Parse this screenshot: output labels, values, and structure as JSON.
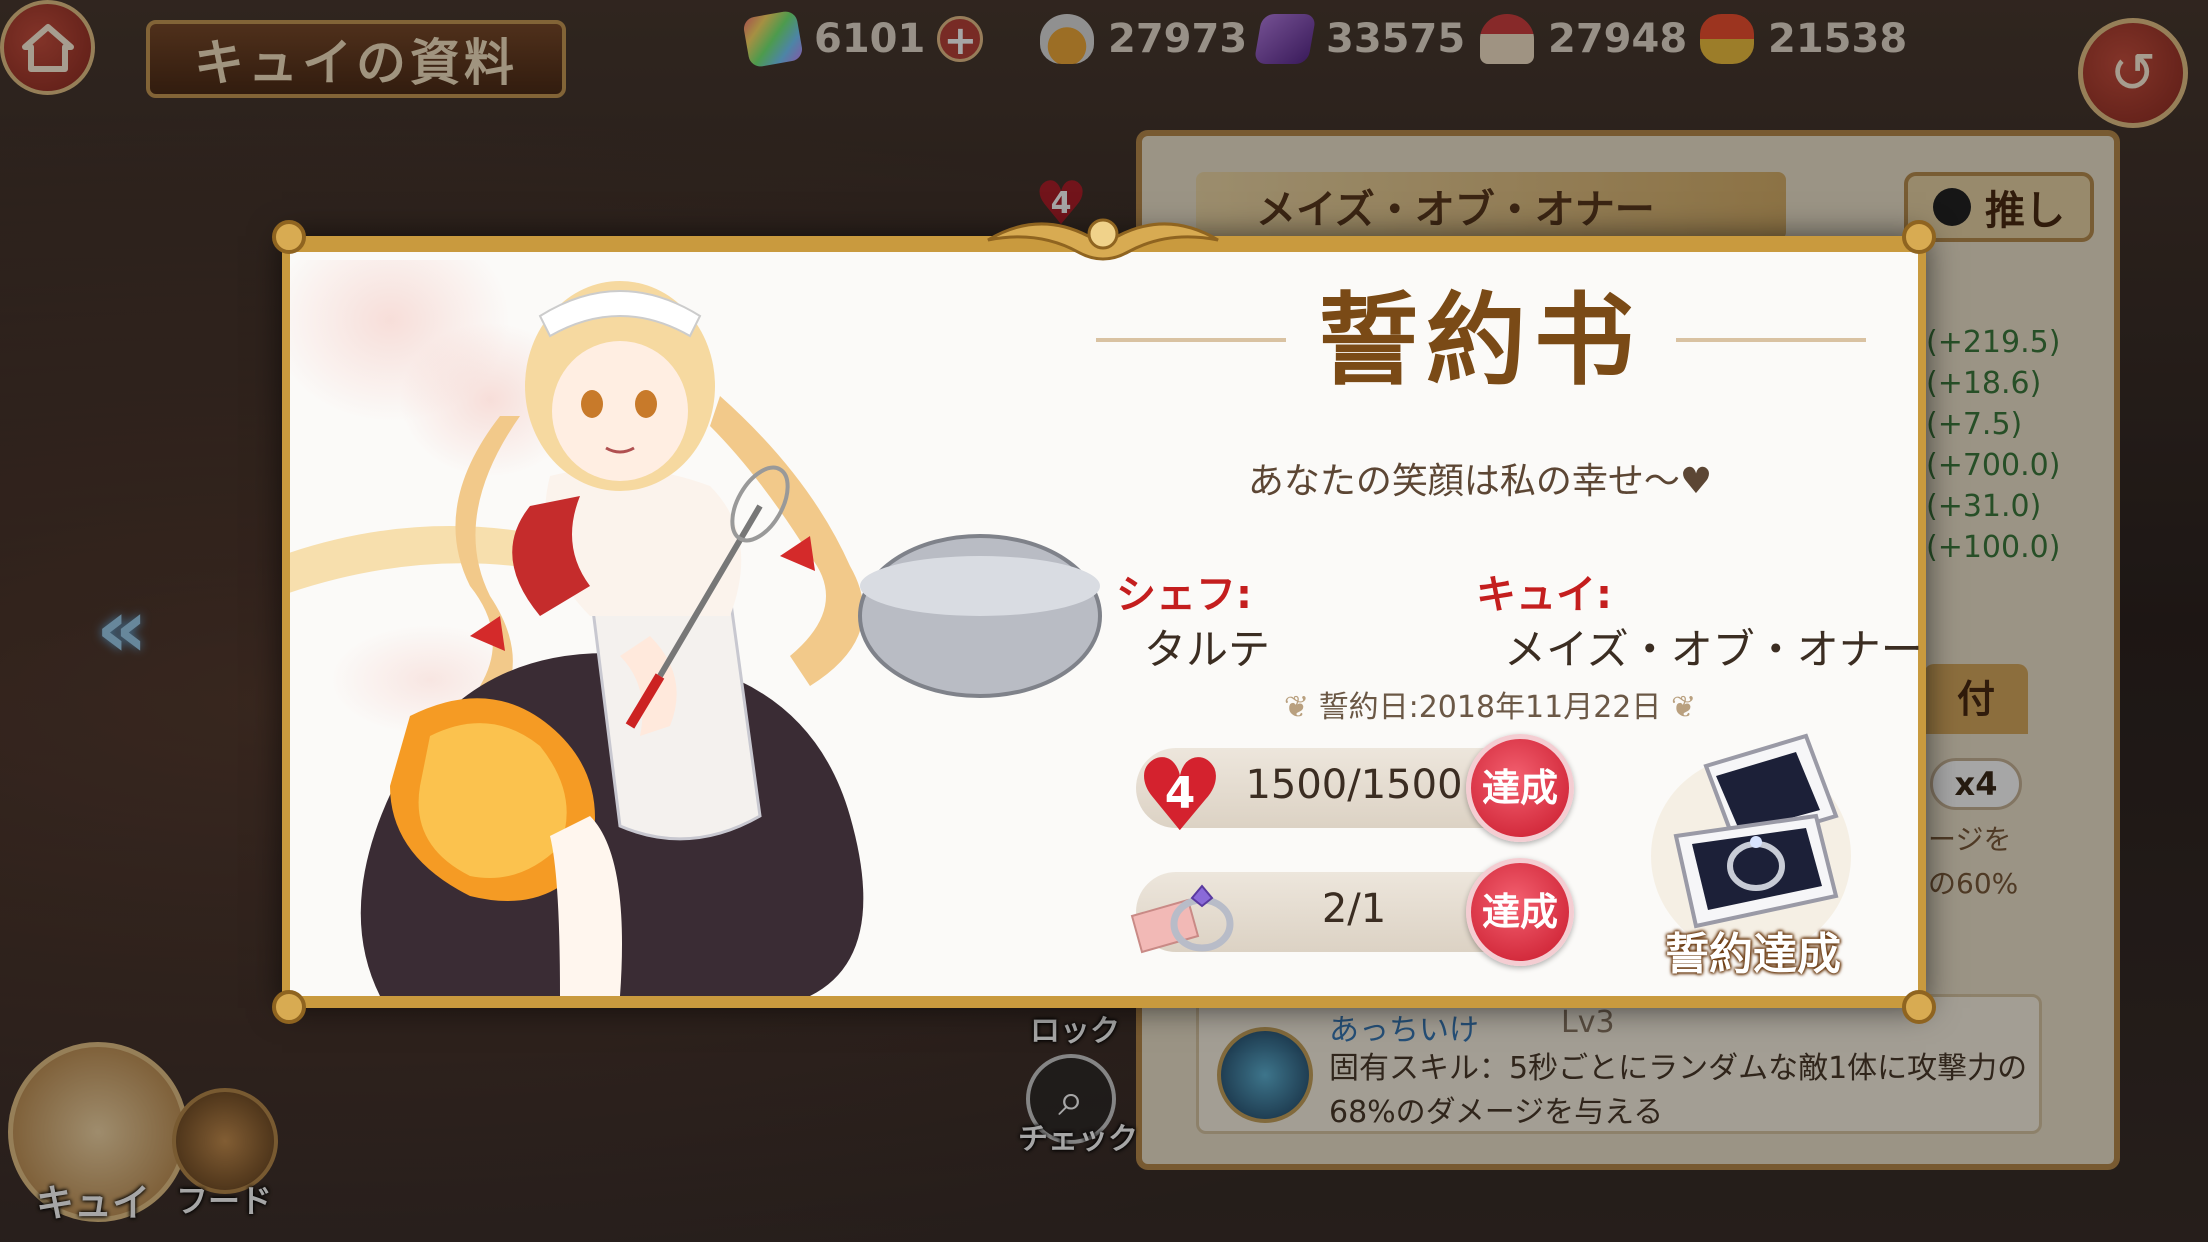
{
  "header": {
    "title": "キュイの資料",
    "home_icon": "house-icon",
    "back_icon": "return-icon"
  },
  "resources": [
    {
      "icon": "rainbow-gem-icon",
      "value": "6101",
      "has_plus": true
    },
    {
      "icon": "potion-flask-icon",
      "value": "27973"
    },
    {
      "icon": "purple-crystal-icon",
      "value": "33575"
    },
    {
      "icon": "cake-icon",
      "value": "27948"
    },
    {
      "icon": "drum-icon",
      "value": "21538"
    }
  ],
  "background_panel": {
    "affection_level": "4",
    "character_name": "メイズ・オブ・オナー",
    "oshi_label": "推し",
    "stats": [
      "(+219.5)",
      "(+18.6)",
      "(+7.5)",
      "(+700.0)",
      "(+31.0)",
      "(+100.0)"
    ],
    "tab_label": "付",
    "multiplier": "x4",
    "skill_snippet": [
      "ージを",
      "の60%"
    ],
    "skill": {
      "name": "あっちいけ",
      "level": "Lv3",
      "description": "固有スキル：5秒ごとにランダムな敵1体に攻撃力の68%のダメージを与える"
    }
  },
  "bottom_left": {
    "character_label": "キュイ",
    "food_label": "フード",
    "lock_label": "ロック",
    "check_label": "チェック"
  },
  "modal": {
    "title": "誓約书",
    "vow": "あなたの笑顔は私の幸せ〜♥",
    "chef_label": "シェフ:",
    "chef_name": "タルテ",
    "cui_label": "キュイ:",
    "cui_name": "メイズ・オブ・オナー",
    "date": "誓約日:2018年11月22日",
    "requirements": [
      {
        "icon": "heart-icon",
        "level": "4",
        "progress": "1500/1500",
        "status": "達成"
      },
      {
        "icon": "ring-icon",
        "progress": "2/1",
        "status": "達成"
      }
    ],
    "oath_complete": "誓約達成"
  },
  "colors": {
    "accent_gold": "#c99a3e",
    "achieved_red": "#c8182a",
    "label_red": "#c41e1e"
  }
}
